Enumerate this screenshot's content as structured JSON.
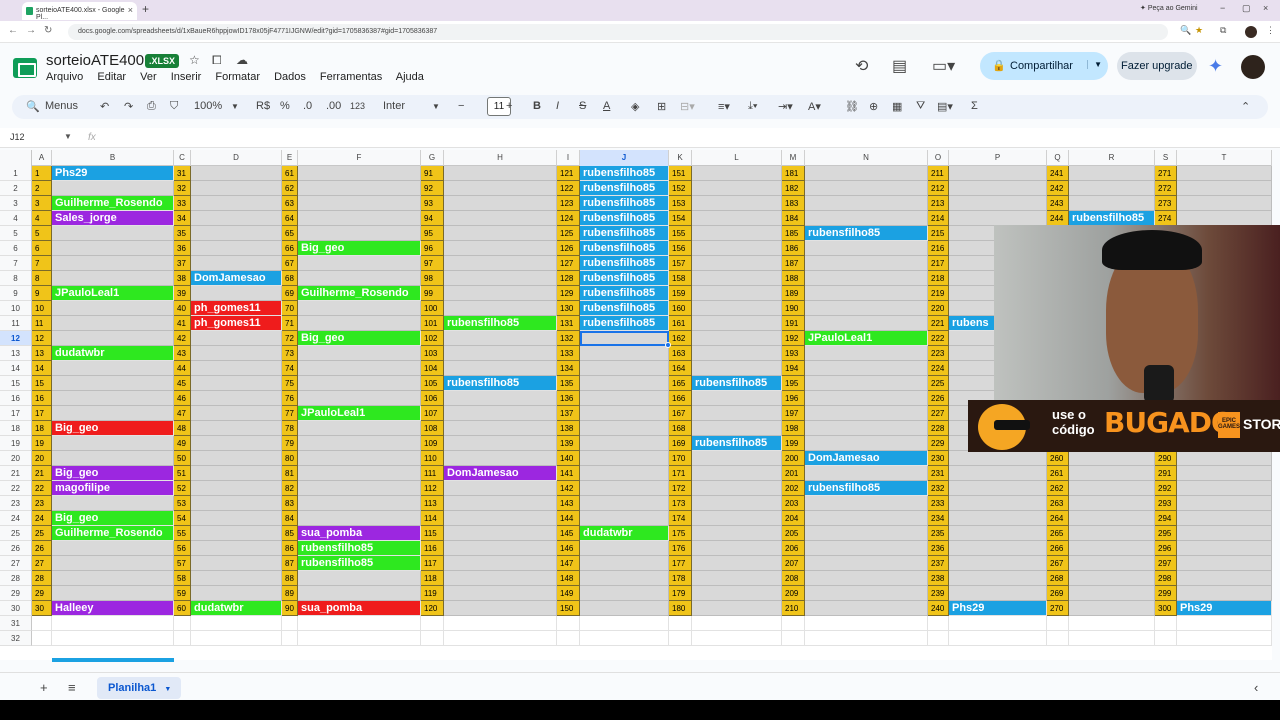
{
  "browser": {
    "tab_title": "sorteioATE400.xlsx - Google Pl...",
    "url": "docs.google.com/spreadsheets/d/1xBaueR6hppjowID178x05jF4771IJGNW/edit?gid=1705836387#gid=1705836387",
    "gemini_label": "Peça ao Gemini"
  },
  "doc": {
    "title": "sorteioATE400",
    "badge": ".XLSX",
    "menu": [
      "Arquivo",
      "Editar",
      "Ver",
      "Inserir",
      "Formatar",
      "Dados",
      "Ferramentas",
      "Ajuda"
    ],
    "share_label": "Compartilhar",
    "upgrade_label": "Fazer upgrade"
  },
  "toolbar": {
    "menus_label": "Menus",
    "zoom": "100%",
    "currency": "R$",
    "percent": "%",
    "dec_less": ".0",
    "dec_more": ".00",
    "format_num": "123",
    "font": "Inter",
    "font_size": "11"
  },
  "formula": {
    "cell_ref": "J12",
    "fx": "fx"
  },
  "columns": [
    "A",
    "B",
    "C",
    "D",
    "E",
    "F",
    "G",
    "H",
    "I",
    "J",
    "K",
    "L",
    "M",
    "N",
    "O",
    "P",
    "Q",
    "R",
    "S",
    "T"
  ],
  "selected_col": "J",
  "selected_row": 12,
  "rows": [
    1,
    2,
    3,
    4,
    5,
    6,
    7,
    8,
    9,
    10,
    11,
    12,
    13,
    14,
    15,
    16,
    17,
    18,
    19,
    20,
    21,
    22,
    23,
    24,
    25,
    26,
    27,
    28,
    29,
    30,
    31,
    32
  ],
  "names": {
    "B": {
      "1": [
        "Phs29",
        "blue"
      ],
      "3": [
        "Guilherme_Rosendo",
        "green"
      ],
      "4": [
        "Sales_jorge",
        "purple"
      ],
      "9": [
        "JPauloLeal1",
        "green"
      ],
      "13": [
        "dudatwbr",
        "green"
      ],
      "18": [
        "Big_geo",
        "red"
      ],
      "21": [
        "Big_geo",
        "purple"
      ],
      "22": [
        "magofilipe",
        "purple"
      ],
      "24": [
        "Big_geo",
        "green"
      ],
      "25": [
        "Guilherme_Rosendo",
        "green"
      ],
      "30": [
        "Halleey",
        "purple"
      ]
    },
    "D": {
      "8": [
        "DomJamesao",
        "blue"
      ],
      "10": [
        "ph_gomes11",
        "red"
      ],
      "11": [
        "ph_gomes11",
        "red"
      ],
      "30": [
        "dudatwbr",
        "green"
      ]
    },
    "F": {
      "6": [
        "Big_geo",
        "green"
      ],
      "9": [
        "Guilherme_Rosendo",
        "green"
      ],
      "12": [
        "Big_geo",
        "green"
      ],
      "17": [
        "JPauloLeal1",
        "green"
      ],
      "25": [
        "sua_pomba",
        "purple"
      ],
      "26": [
        "rubensfilho85",
        "green"
      ],
      "27": [
        "rubensfilho85",
        "green"
      ],
      "30": [
        "sua_pomba",
        "red"
      ]
    },
    "H": {
      "11": [
        "rubensfilho85",
        "green"
      ],
      "15": [
        "rubensfilho85",
        "blue"
      ],
      "21": [
        "DomJamesao",
        "purple"
      ]
    },
    "J": {
      "1": [
        "rubensfilho85",
        "blue"
      ],
      "2": [
        "rubensfilho85",
        "blue"
      ],
      "3": [
        "rubensfilho85",
        "blue"
      ],
      "4": [
        "rubensfilho85",
        "blue"
      ],
      "5": [
        "rubensfilho85",
        "blue"
      ],
      "6": [
        "rubensfilho85",
        "blue"
      ],
      "7": [
        "rubensfilho85",
        "blue"
      ],
      "8": [
        "rubensfilho85",
        "blue"
      ],
      "9": [
        "rubensfilho85",
        "blue"
      ],
      "10": [
        "rubensfilho85",
        "blue"
      ],
      "11": [
        "rubensfilho85",
        "blue"
      ],
      "25": [
        "dudatwbr",
        "green"
      ]
    },
    "L": {
      "15": [
        "rubensfilho85",
        "blue"
      ],
      "19": [
        "rubensfilho85",
        "blue"
      ]
    },
    "N": {
      "5": [
        "rubensfilho85",
        "blue"
      ],
      "12": [
        "JPauloLeal1",
        "green"
      ],
      "20": [
        "DomJamesao",
        "blue"
      ],
      "22": [
        "rubensfilho85",
        "blue"
      ]
    },
    "P": {
      "11": [
        "rubens",
        "blue"
      ],
      "30": [
        "Phs29",
        "blue"
      ]
    },
    "R": {
      "4": [
        "rubensfilho85",
        "blue"
      ]
    },
    "T": {
      "30": [
        "Phs29",
        "blue"
      ]
    }
  },
  "colors": {
    "blue": "#1ba1e2",
    "green": "#2ee81f",
    "purple": "#9c27e0",
    "red": "#ef1c1c",
    "number_cell": "#f0c419",
    "empty_cell": "#d9d9d9"
  },
  "sheet_tab": "Planilha1",
  "overlay": {
    "promo_line1": "use o",
    "promo_line2": "código",
    "promo_brand": "BUGADO",
    "promo_epic": "EPIC GAMES",
    "promo_store": "STORE"
  }
}
